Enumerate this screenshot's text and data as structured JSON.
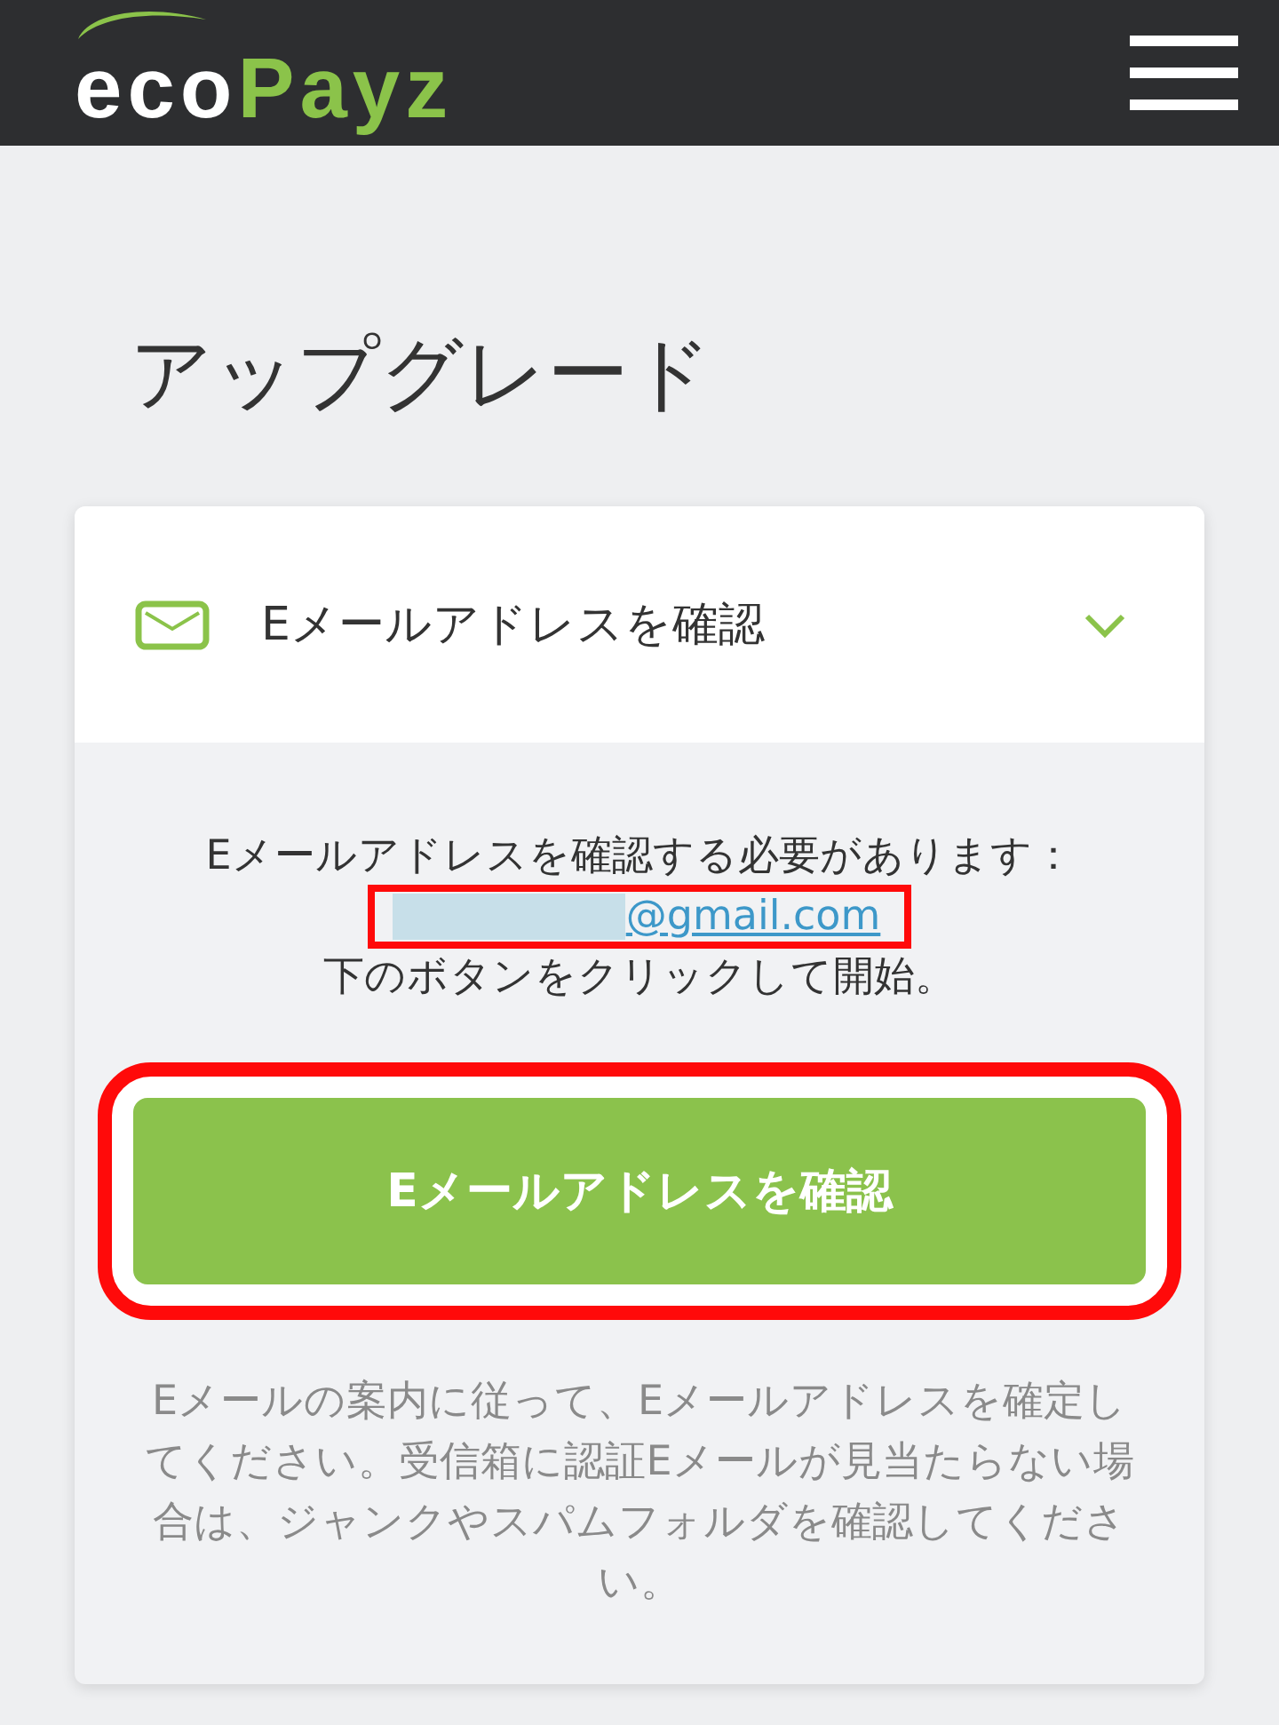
{
  "header": {
    "logo": {
      "part_1": "eco",
      "part_2": "Payz"
    }
  },
  "page_title": "アップグレード",
  "section": {
    "title": "Eメールアドレスを確認",
    "expanded": true,
    "message": "Eメールアドレスを確認する必要があります：",
    "email": {
      "text": "@gmail.com",
      "redacted": true,
      "highlighted": true
    },
    "instruction": "下のボタンをクリックして開始。",
    "button": {
      "label": "Eメールアドレスを確認",
      "highlighted": true
    },
    "note": "Eメールの案内に従って、Eメールアドレスを確定してください。受信箱に認証Eメールが見当たらない場合は、ジャンクやスパムフォルダを確認してください。"
  }
}
